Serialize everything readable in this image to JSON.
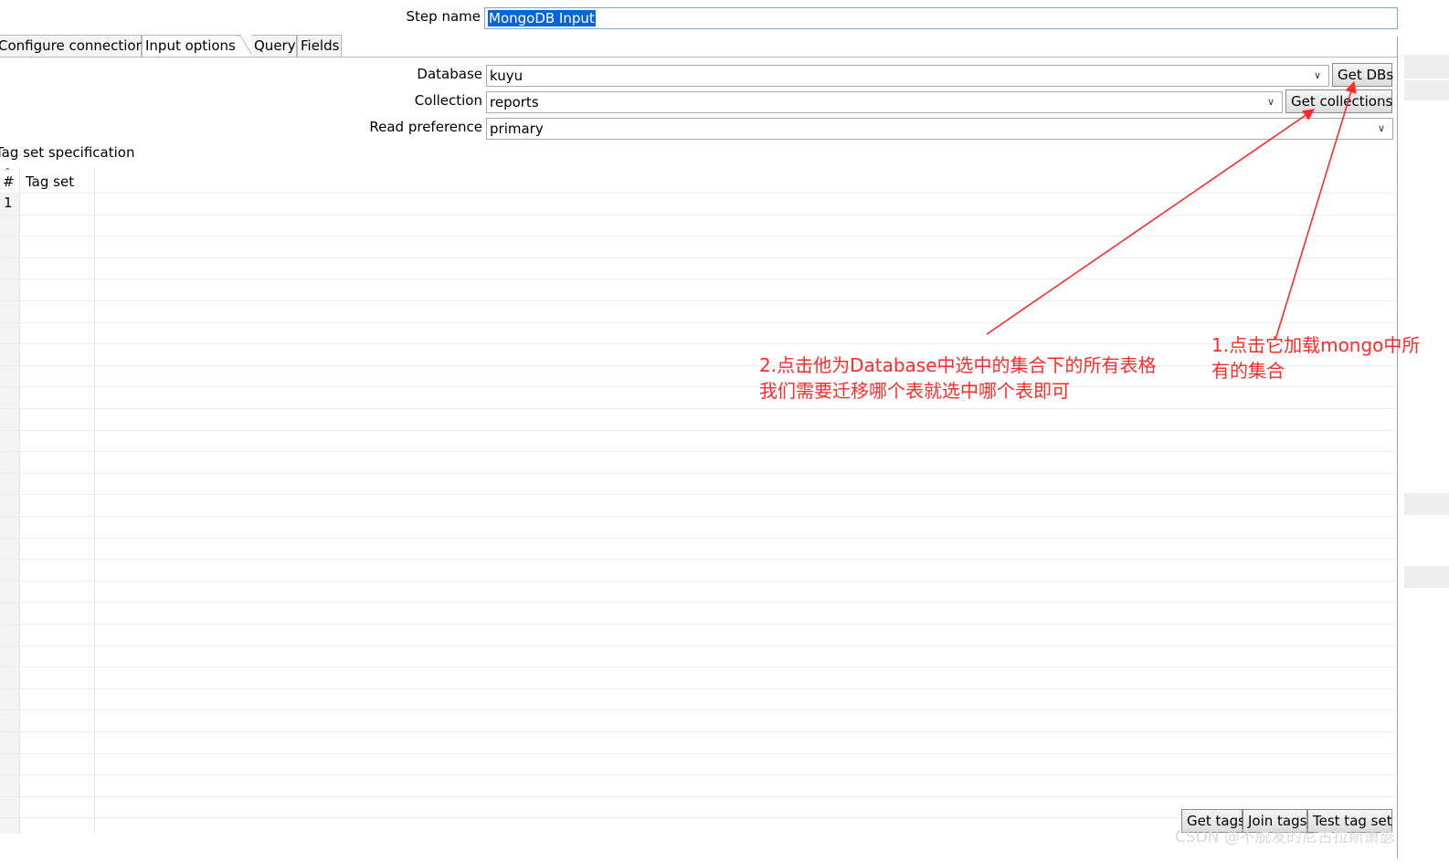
{
  "step_name": {
    "label": "Step name",
    "value": "MongoDB Input"
  },
  "tabs": [
    {
      "label": "Configure connection"
    },
    {
      "label": "Input options"
    },
    {
      "label": "Query"
    },
    {
      "label": "Fields"
    }
  ],
  "database": {
    "label": "Database",
    "value": "kuyu",
    "button": "Get DBs"
  },
  "collection": {
    "label": "Collection",
    "value": "reports",
    "button": "Get collections"
  },
  "read_preference": {
    "label": "Read preference",
    "value": "primary"
  },
  "tag_set": {
    "section_label": "Tag set specification",
    "columns": [
      "#",
      "Tag set"
    ],
    "rows": [
      {
        "num": "1",
        "tag_set": ""
      }
    ]
  },
  "bottom_buttons": {
    "get_tags": "Get tags",
    "join_tags": "Join tags",
    "test_tag_set": "Test tag set"
  },
  "annotations": {
    "note1_line1": "1.点击它加载mongo中所",
    "note1_line2": "有的集合",
    "note2_line1": "2.点击他为Database中选中的集合下的所有表格",
    "note2_line2": "我们需要迁移哪个表就选中哪个表即可"
  },
  "watermark": "CSDN @不脱发的尼古拉斯萧瑟",
  "colors": {
    "annotation": "#ff2a2a",
    "selection": "#0a64d6"
  }
}
